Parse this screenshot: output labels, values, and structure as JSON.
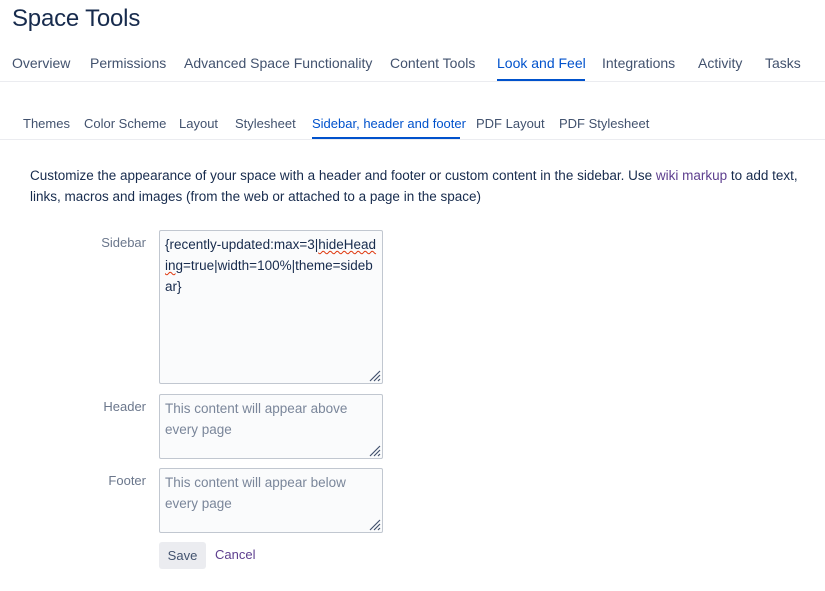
{
  "page": {
    "title": "Space Tools"
  },
  "main_tabs": [
    {
      "label": "Overview"
    },
    {
      "label": "Permissions"
    },
    {
      "label": "Advanced Space Functionality"
    },
    {
      "label": "Content Tools"
    },
    {
      "label": "Look and Feel",
      "active": true
    },
    {
      "label": "Integrations"
    },
    {
      "label": "Activity"
    },
    {
      "label": "Tasks"
    }
  ],
  "sub_tabs": [
    {
      "label": "Themes"
    },
    {
      "label": "Color Scheme"
    },
    {
      "label": "Layout"
    },
    {
      "label": "Stylesheet"
    },
    {
      "label": "Sidebar, header and footer",
      "active": true
    },
    {
      "label": "PDF Layout"
    },
    {
      "label": "PDF Stylesheet"
    }
  ],
  "description": {
    "before_link": "Customize the appearance of your space with a header and footer or custom content in the sidebar. Use ",
    "link": "wiki markup",
    "after_link": " to add text, links, macros and images (from the web or attached to a page in the space)"
  },
  "form": {
    "sidebar": {
      "label": "Sidebar",
      "value_before": "{recently-updated:max=3|",
      "value_misspelled": "hideHeading",
      "value_after": "=true|width=100%|theme=sidebar}"
    },
    "header": {
      "label": "Header",
      "placeholder": "This content will appear above every page"
    },
    "footer": {
      "label": "Footer",
      "placeholder": "This content will appear below every page"
    },
    "save_label": "Save",
    "cancel_label": "Cancel"
  },
  "colors": {
    "accent": "#0052cc",
    "link_visited": "#5e3f8f",
    "text": "#172b4d",
    "muted": "#6b778c"
  }
}
